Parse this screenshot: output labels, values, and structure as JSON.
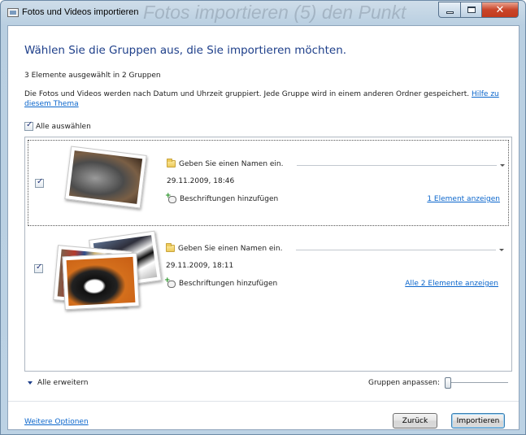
{
  "window": {
    "title": "Fotos und Videos importieren",
    "background_text": "Fotos importieren (5) den Punkt"
  },
  "main": {
    "heading": "Wählen Sie die Gruppen aus, die Sie importieren möchten.",
    "selection_count": "3 Elemente ausgewählt in 2 Gruppen",
    "description": "Die Fotos und Videos werden nach Datum und Uhrzeit gruppiert. Jede Gruppe wird in einem anderen Ordner gespeichert.",
    "help_link": "Hilfe zu diesem Thema",
    "select_all_label": "Alle auswählen",
    "select_all_checked": true
  },
  "groups": [
    {
      "checked": true,
      "selected": true,
      "name_placeholder": "Geben Sie einen Namen ein.",
      "datetime": "29.11.2009, 18:46",
      "tags_label": "Beschriftungen hinzufügen",
      "show_link": "1 Element anzeigen",
      "thumbnails": 1
    },
    {
      "checked": true,
      "selected": false,
      "name_placeholder": "Geben Sie einen Namen ein.",
      "datetime": "29.11.2009, 18:11",
      "tags_label": "Beschriftungen hinzufügen",
      "show_link": "Alle 2 Elemente anzeigen",
      "thumbnails": 2
    }
  ],
  "footer": {
    "expand_all": "Alle erweitern",
    "adjust_groups": "Gruppen anpassen:",
    "slider_value": 0,
    "more_options": "Weitere Optionen",
    "back_button": "Zurück",
    "import_button": "Importieren"
  },
  "icons": {
    "app": "photo-import-icon",
    "folder": "folder-icon",
    "tag": "tag-add-icon",
    "expand": "chevron-down-icon"
  },
  "colors": {
    "heading": "#1e3f8a",
    "link": "#0b66cc",
    "close_button": "#c9452a"
  }
}
